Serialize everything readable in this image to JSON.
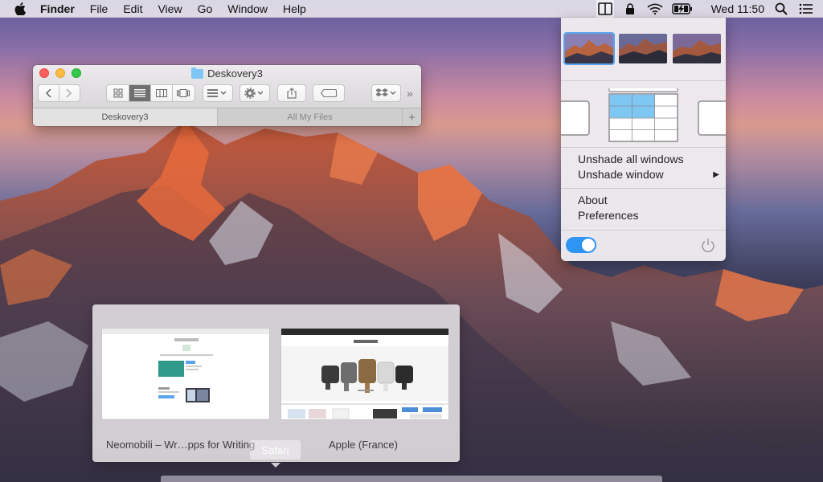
{
  "menubar": {
    "apple_icon": "apple-icon",
    "app_name": "Finder",
    "items": [
      "File",
      "Edit",
      "View",
      "Go",
      "Window",
      "Help"
    ],
    "status_icons": [
      "deskovery-icon",
      "lock-icon",
      "wifi-icon",
      "battery-icon"
    ],
    "clock": "Wed 11:50",
    "search_icon": "search-icon",
    "notification_icon": "list-icon"
  },
  "finder_window": {
    "title": "Deskovery3",
    "tabs": [
      "Deskovery3",
      "All My Files"
    ],
    "add_tab": "+",
    "overflow": "»"
  },
  "popover": {
    "thumbnails": [
      "wallpaper-1",
      "wallpaper-2",
      "wallpaper-3"
    ],
    "menu": {
      "unshade_all": "Unshade all windows",
      "unshade_window": "Unshade window",
      "submenu_arrow": "▶",
      "about": "About",
      "preferences": "Preferences"
    },
    "toggle_on": true
  },
  "switcher": {
    "windows": [
      {
        "label": "Neomobili – Wr…pps for Writing"
      },
      {
        "label": "Apple (France)"
      }
    ],
    "app_label": "Safari"
  },
  "colors": {
    "accent": "#2e95f5",
    "selected_outline": "#5aa4ee",
    "grid_highlight": "#7dc7f2"
  }
}
